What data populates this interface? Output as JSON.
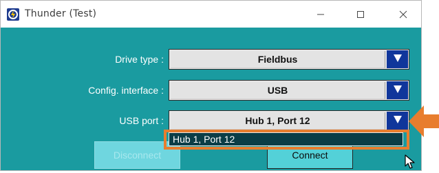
{
  "window": {
    "title": "Thunder (Test)"
  },
  "colors": {
    "body": "#1a9ba0",
    "arrow_button": "#10369b",
    "highlight": "#e87d2e",
    "dropdown_selected": "#0b3d46"
  },
  "form": {
    "drive_type": {
      "label": "Drive type :",
      "value": "Fieldbus"
    },
    "config_interface": {
      "label": "Config. interface :",
      "value": "USB"
    },
    "usb_port": {
      "label": "USB port :",
      "value": "Hub 1, Port 12",
      "options": [
        "Hub 1, Port 12"
      ]
    }
  },
  "buttons": {
    "disconnect": "Disconnect",
    "connect": "Connect"
  },
  "icons": {
    "app": "thunder-app-icon",
    "minimize": "minimize-icon",
    "maximize": "maximize-icon",
    "close": "close-icon",
    "dropdown": "triangle-down-icon",
    "pointer": "orange-arrow-pointer-icon",
    "cursor": "mouse-cursor-icon"
  }
}
